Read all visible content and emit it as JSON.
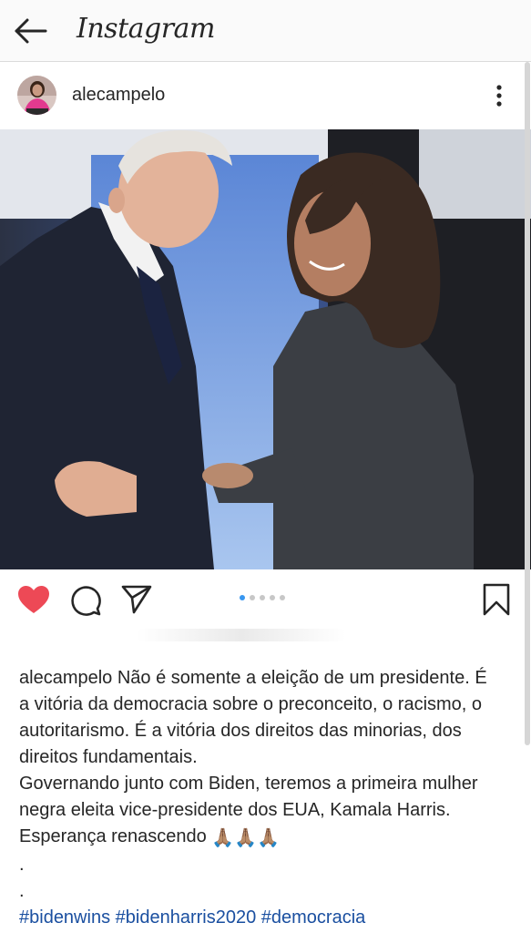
{
  "app": {
    "title": "Instagram"
  },
  "post": {
    "username": "alecampelo",
    "caption_lines": [
      "Não é somente a eleição de um presidente. É",
      "a vitória da democracia sobre o preconceito, o racismo, o",
      "autoritarismo. É a vitória dos direitos das minorias, dos",
      "direitos fundamentais.",
      "Governando junto com Biden, teremos a primeira mulher",
      "negra eleita vice-presidente dos EUA, Kamala Harris.",
      "Esperança renascendo"
    ],
    "emojis": "🙏🏽🙏🏽🙏🏽",
    "dot_line_1": ".",
    "dot_line_2": ".",
    "hashtags": [
      "#bidenwins",
      "#bidenharris2020",
      "#democracia"
    ],
    "carousel": {
      "count": 5,
      "active_index": 0
    },
    "liked": true
  },
  "colors": {
    "heart": "#ed4956",
    "link": "#1a4fa0",
    "carousel_active": "#3897f0"
  }
}
